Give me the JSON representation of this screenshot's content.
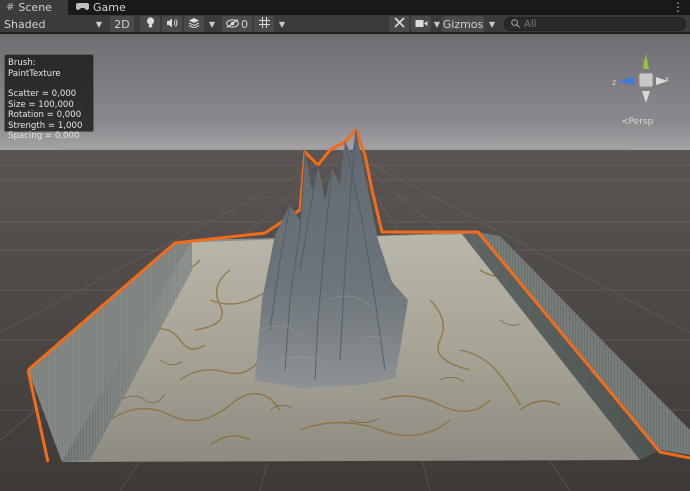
{
  "tabs": {
    "scene_label": "Scene",
    "game_label": "Game"
  },
  "toolbar": {
    "draw_mode": "Shaded",
    "mode_2d": "2D",
    "hidden_count": "0",
    "gizmos_label": "Gizmos",
    "search_placeholder": "All"
  },
  "brush": {
    "title": "Brush: PaintTexture",
    "scatter": "Scatter = 0,000",
    "size": "Size = 100,000",
    "rotation": "Rotation = 0,000",
    "strength": "Strength = 1,000",
    "spacing": "Spacing = 0,000"
  },
  "view_gizmo": {
    "projection": "Persp",
    "axis_y": "y",
    "axis_z": "z",
    "axis_x": "x"
  },
  "colors": {
    "selection_outline": "#f26c1a",
    "sky_top": "#7c7a80",
    "ground": "#4e4a47"
  }
}
